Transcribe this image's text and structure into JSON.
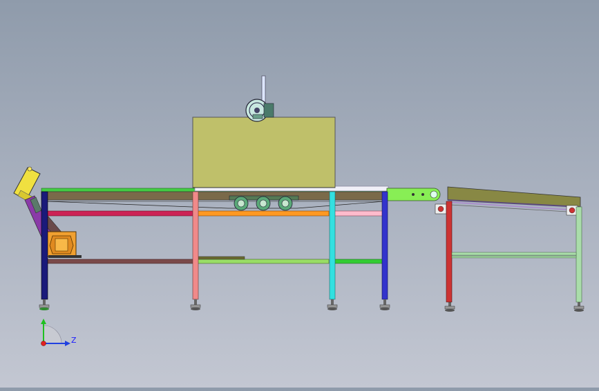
{
  "viewport": {
    "background_top": "#8f9bab",
    "background_bottom": "#c3c7d2"
  },
  "triad": {
    "axis_label": "Z",
    "colors": {
      "x": "#e02020",
      "y": "#20c020",
      "z": "#2040e0"
    }
  },
  "parts": {
    "hood_color": "#bfc06a",
    "frame_leg_colors": [
      "#1a1a7a",
      "#f08a8a",
      "#33e0e0",
      "#3333cc"
    ],
    "rail_colors": [
      "#44cc44",
      "#cc2255",
      "#ff9922",
      "#7a4a4a",
      "#99dd66"
    ],
    "motor_color": "#f0a030",
    "incline_color": "#f0e040",
    "aux_frame_colors": [
      "#cc3333",
      "#aaddaa",
      "#888844"
    ]
  }
}
